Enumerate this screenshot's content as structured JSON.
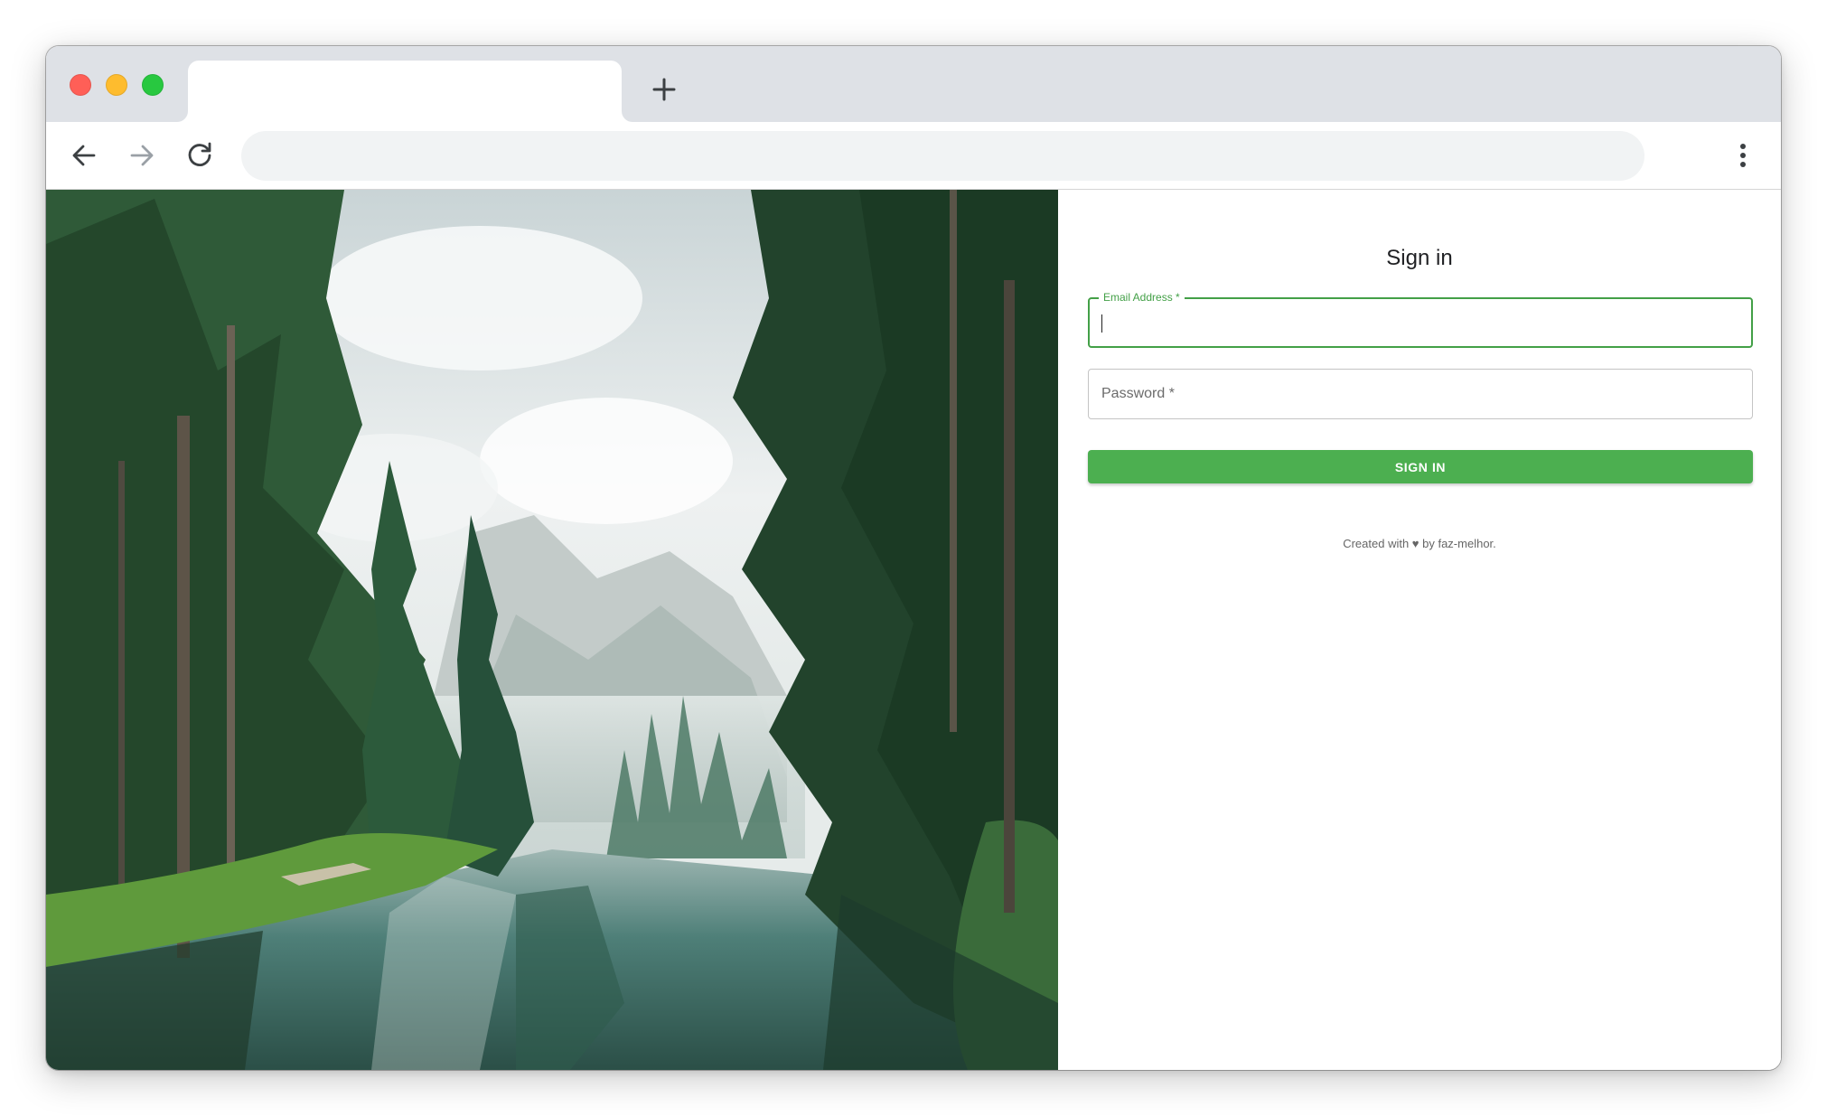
{
  "browser": {
    "tab_title": "",
    "address": "",
    "new_tab_icon": "plus-icon",
    "back_icon": "arrow-left-icon",
    "forward_icon": "arrow-right-icon",
    "reload_icon": "reload-icon",
    "menu_icon": "more-vertical-icon"
  },
  "login": {
    "title": "Sign in",
    "email_label": "Email Address *",
    "email_value": "",
    "password_placeholder": "Password *",
    "button_label": "SIGN IN",
    "footer": "Created with ♥ by faz-melhor."
  },
  "colors": {
    "accent": "#4caf50",
    "focus_border": "#43a047",
    "tabbar": "#dee1e6"
  }
}
